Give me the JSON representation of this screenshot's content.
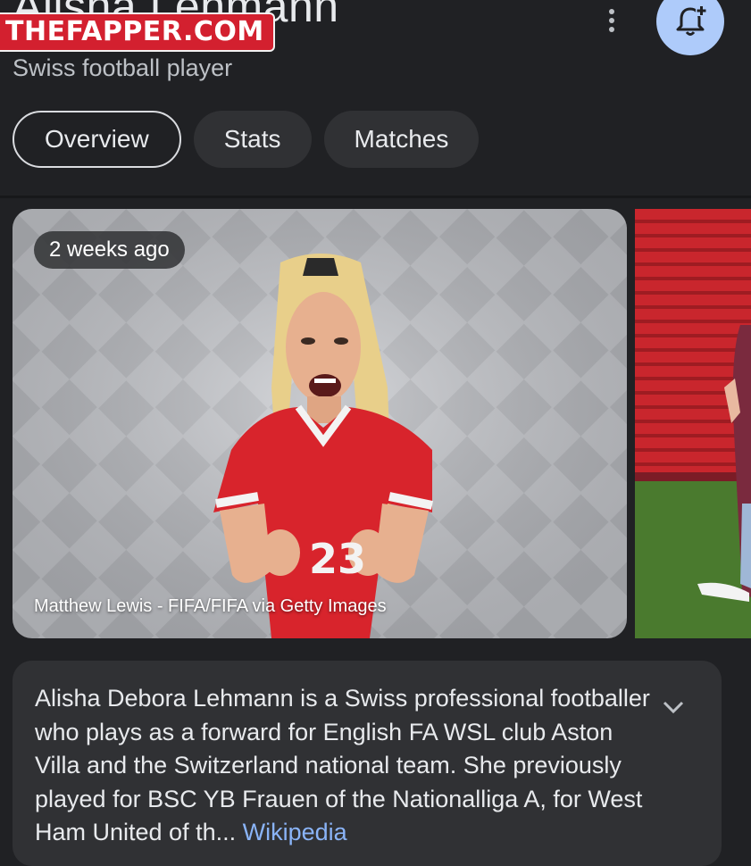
{
  "header": {
    "title": "Alisha Lehmann",
    "subtitle": "Swiss football player",
    "more_icon": "more-vert-icon",
    "bell_icon": "add-notification-bell-icon",
    "accent": "#aecbfa"
  },
  "watermark": {
    "text": "THEFAPPER.COM",
    "color": "#d3202f"
  },
  "tabs": [
    {
      "label": "Overview",
      "active": true
    },
    {
      "label": "Stats",
      "active": false
    },
    {
      "label": "Matches",
      "active": false
    }
  ],
  "media": {
    "time_chip": "2 weeks ago",
    "credit": "Matthew Lewis - FIFA/FIFA via Getty Images",
    "jersey_number": "23"
  },
  "description": {
    "text": "Alisha Debora Lehmann is a Swiss professional footballer who plays as a forward for English FA WSL club Aston Villa and the Switzerland national team. She previously played for BSC YB Frauen of the Nationalliga A, for West Ham United of th",
    "ellipsis": "...",
    "source_link": "Wikipedia",
    "expand_icon": "chevron-down-icon"
  }
}
